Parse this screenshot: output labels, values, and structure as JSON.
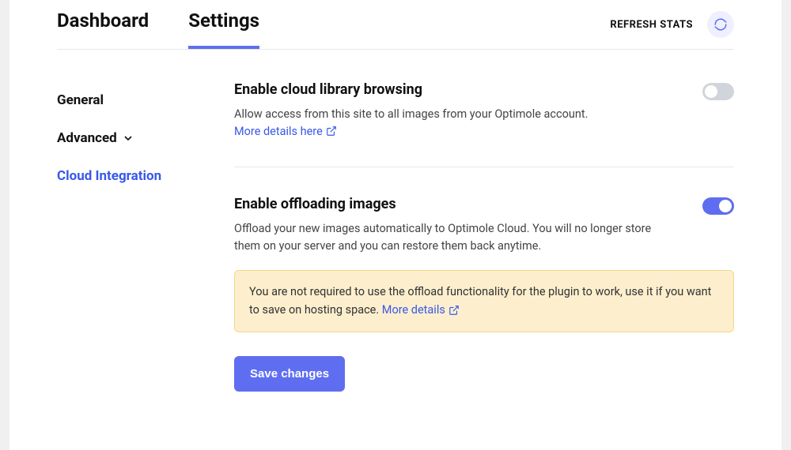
{
  "tabs": {
    "dashboard": "Dashboard",
    "settings": "Settings"
  },
  "top_actions": {
    "refresh_stats": "REFRESH STATS"
  },
  "sidebar": {
    "general": "General",
    "advanced": "Advanced",
    "cloud_integration": "Cloud Integration"
  },
  "settings_blocks": {
    "cloud_library": {
      "title": "Enable cloud library browsing",
      "desc": "Allow access from this site to all images from your Optimole account.",
      "link": "More details here",
      "enabled": false
    },
    "offloading": {
      "title": "Enable offloading images",
      "desc": "Offload your new images automatically to Optimole Cloud. You will no longer store them on your server and you can restore them back anytime.",
      "enabled": true
    }
  },
  "notice": {
    "text": "You are not required to use the offload functionality for the plugin to work, use it if you want to save on hosting space. ",
    "link": "More details"
  },
  "save_button": "Save changes"
}
